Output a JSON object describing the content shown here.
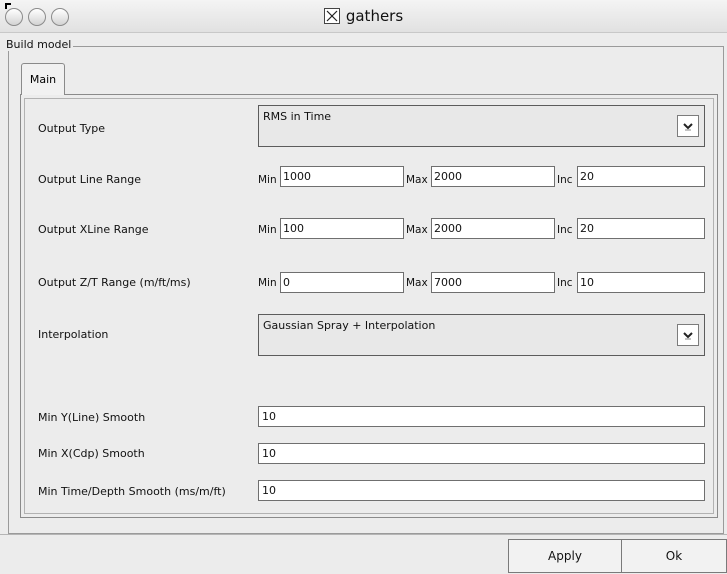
{
  "window": {
    "title": "gathers"
  },
  "group": {
    "label": "Build model"
  },
  "tabs": [
    {
      "label": "Main",
      "active": true
    }
  ],
  "form": {
    "output_type": {
      "label": "Output Type",
      "value": "RMS in Time"
    },
    "line_range": {
      "label": "Output Line Range",
      "min_label": "Min",
      "min": "1000",
      "max_label": "Max",
      "max": "2000",
      "inc_label": "Inc",
      "inc": "20"
    },
    "xline_range": {
      "label": "Output XLine Range",
      "min_label": "Min",
      "min": "100",
      "max_label": "Max",
      "max": "2000",
      "inc_label": "Inc",
      "inc": "20"
    },
    "zt_range": {
      "label": "Output Z/T Range (m/ft/ms)",
      "min_label": "Min",
      "min": "0",
      "max_label": "Max",
      "max": "7000",
      "inc_label": "Inc",
      "inc": "10"
    },
    "interpolation": {
      "label": "Interpolation",
      "value": "Gaussian Spray + Interpolation"
    },
    "min_y_smooth": {
      "label": "Min Y(Line) Smooth",
      "value": "10"
    },
    "min_x_smooth": {
      "label": "Min X(Cdp) Smooth",
      "value": "10"
    },
    "min_time_smooth": {
      "label": "Min Time/Depth Smooth (ms/m/ft)",
      "value": "10"
    }
  },
  "buttons": {
    "apply": "Apply",
    "ok": "Ok"
  },
  "icons": {
    "window_controls": [
      "close-button-icon",
      "minimize-button-icon",
      "zoom-button-icon"
    ],
    "app_icon": "x11-icon",
    "dropdown": "chevron-down-icon"
  }
}
